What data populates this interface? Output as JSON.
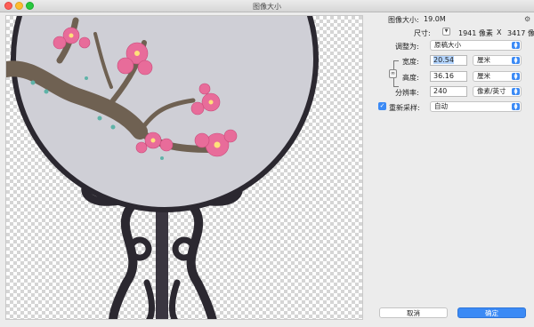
{
  "window": {
    "title": "图像大小"
  },
  "info": {
    "image_size_label": "图像大小:",
    "image_size_value": "19.0M"
  },
  "dimensions": {
    "label": "尺寸:",
    "width_px": "1941 像素",
    "separator": "X",
    "height_px": "3417 像素"
  },
  "fit": {
    "label": "调整为:",
    "value": "原稿大小"
  },
  "width": {
    "label": "宽度:",
    "value": "20.54",
    "unit": "厘米"
  },
  "height": {
    "label": "高度:",
    "value": "36.16",
    "unit": "厘米"
  },
  "resolution": {
    "label": "分辨率:",
    "value": "240",
    "unit": "像素/英寸"
  },
  "resample": {
    "label": "重新采样:",
    "value": "自动",
    "checked": true
  },
  "buttons": {
    "cancel": "取消",
    "ok": "确定"
  },
  "icons": {
    "gear": "gear-icon",
    "dimensions_toggle": "chevron-down-icon",
    "constrain": "link-icon",
    "checkbox": "check-icon"
  },
  "colors": {
    "accent": "#3b8af5",
    "fan_frame": "#2b2830",
    "fan_silk": "#cfcfd6",
    "blossom": "#e86c9a"
  }
}
